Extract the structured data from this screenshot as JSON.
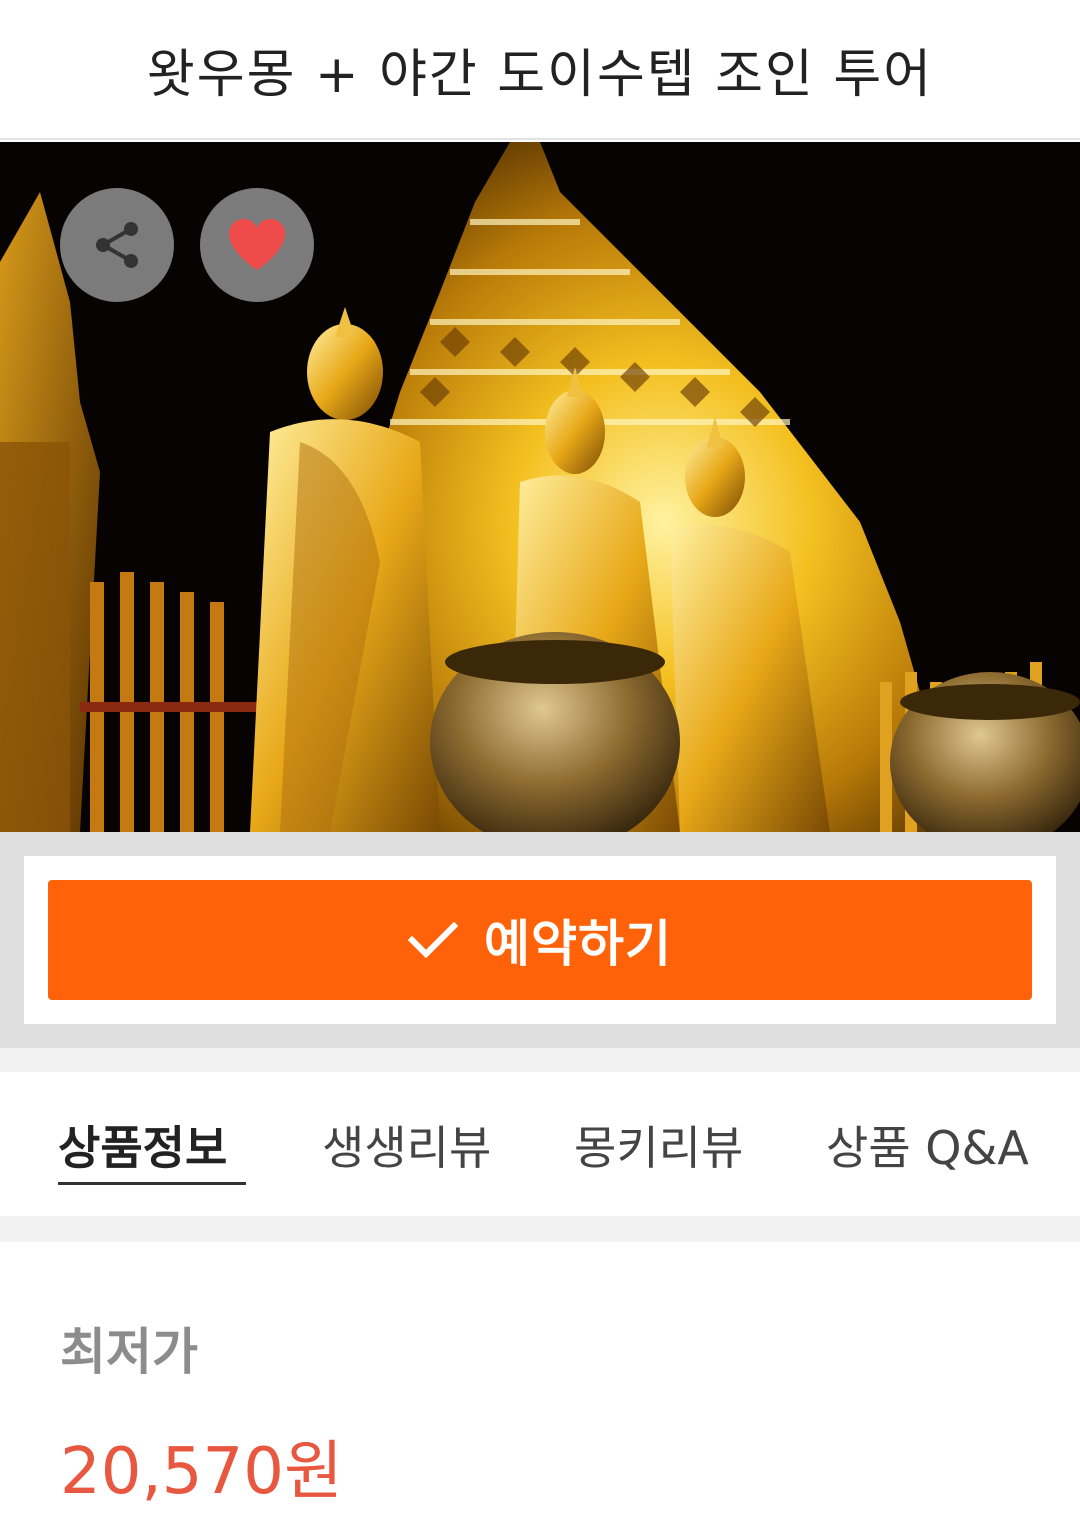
{
  "header": {
    "title": "왓우몽 + 야간 도이수텝 조인 투어"
  },
  "hero": {
    "share_icon": "share-icon",
    "like_icon": "heart-icon",
    "heart_color": "#ef4b4b"
  },
  "booking": {
    "icon": "check-icon",
    "label": "예약하기",
    "color": "#ff6208"
  },
  "tabs": [
    {
      "label": "상품정보",
      "active": true
    },
    {
      "label": "생생리뷰",
      "active": false
    },
    {
      "label": "몽키리뷰",
      "active": false
    },
    {
      "label": "상품 Q&A",
      "active": false
    }
  ],
  "price": {
    "label": "최저가",
    "value": "20,570원",
    "color": "#e8573f"
  }
}
